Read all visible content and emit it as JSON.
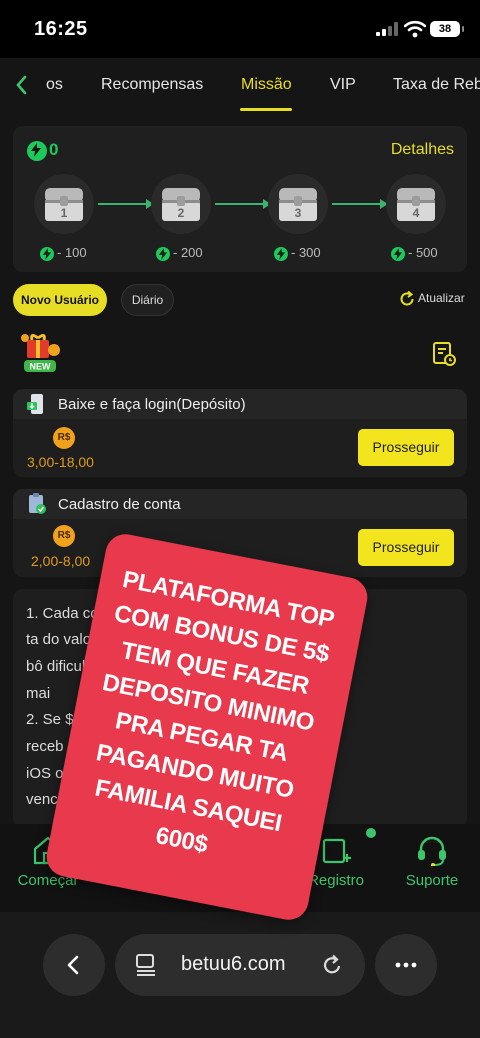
{
  "status_bar": {
    "time": "16:25",
    "battery": "38"
  },
  "tabs": {
    "items": [
      {
        "label": "os"
      },
      {
        "label": "Recompensas"
      },
      {
        "label": "Missão",
        "active": true
      },
      {
        "label": "VIP"
      },
      {
        "label": "Taxa de Reb"
      }
    ]
  },
  "progress": {
    "count": "0",
    "details_label": "Detalhes",
    "chests": [
      {
        "num": "1",
        "req": "- 100"
      },
      {
        "num": "2",
        "req": "- 200"
      },
      {
        "num": "3",
        "req": "- 300"
      },
      {
        "num": "4",
        "req": "- 500"
      }
    ]
  },
  "filters": {
    "new_user": "Novo Usuário",
    "daily": "Diário",
    "refresh": "Atualizar"
  },
  "badge": {
    "new": "NEW"
  },
  "tasks": [
    {
      "title": "Baixe e faça login(Depósito)",
      "currency": "R$",
      "range": "3,00-18,00",
      "button": "Prosseguir"
    },
    {
      "title": "Cadastro de conta",
      "currency": "R$",
      "range": "2,00-8,00",
      "button": "Prosseguir"
    }
  ],
  "rules": {
    "lines": [
      "1. Cada conta                                        concluir as",
      "ta                                                        do valor de",
      "bô                                                          dificuldade,",
      "mai",
      "2. Se                                                      $ poderá",
      "receb                                                       aplicativo",
      "iOS ou                                                        s o",
      "vencim"
    ]
  },
  "bottom_nav": [
    {
      "label": "Começar",
      "icon": "home-icon"
    },
    {
      "label": "Registro",
      "icon": "register-icon"
    },
    {
      "label": "Suporte",
      "icon": "headset-icon"
    }
  ],
  "browser": {
    "domain": "betuu6.com"
  },
  "overlay": {
    "lines": [
      "PLATAFORMA TOP",
      "COM BONUS DE 5$",
      "TEM QUE FAZER",
      "DEPOSITO MINIMO",
      "PRA PEGAR TA",
      "PAGANDO MUITO",
      "FAMILIA SAQUEI",
      "600$"
    ]
  },
  "colors": {
    "accent": "#e8dd25",
    "green": "#1dc95a",
    "overlay": "#e8394d",
    "orange": "#e09a1b"
  }
}
